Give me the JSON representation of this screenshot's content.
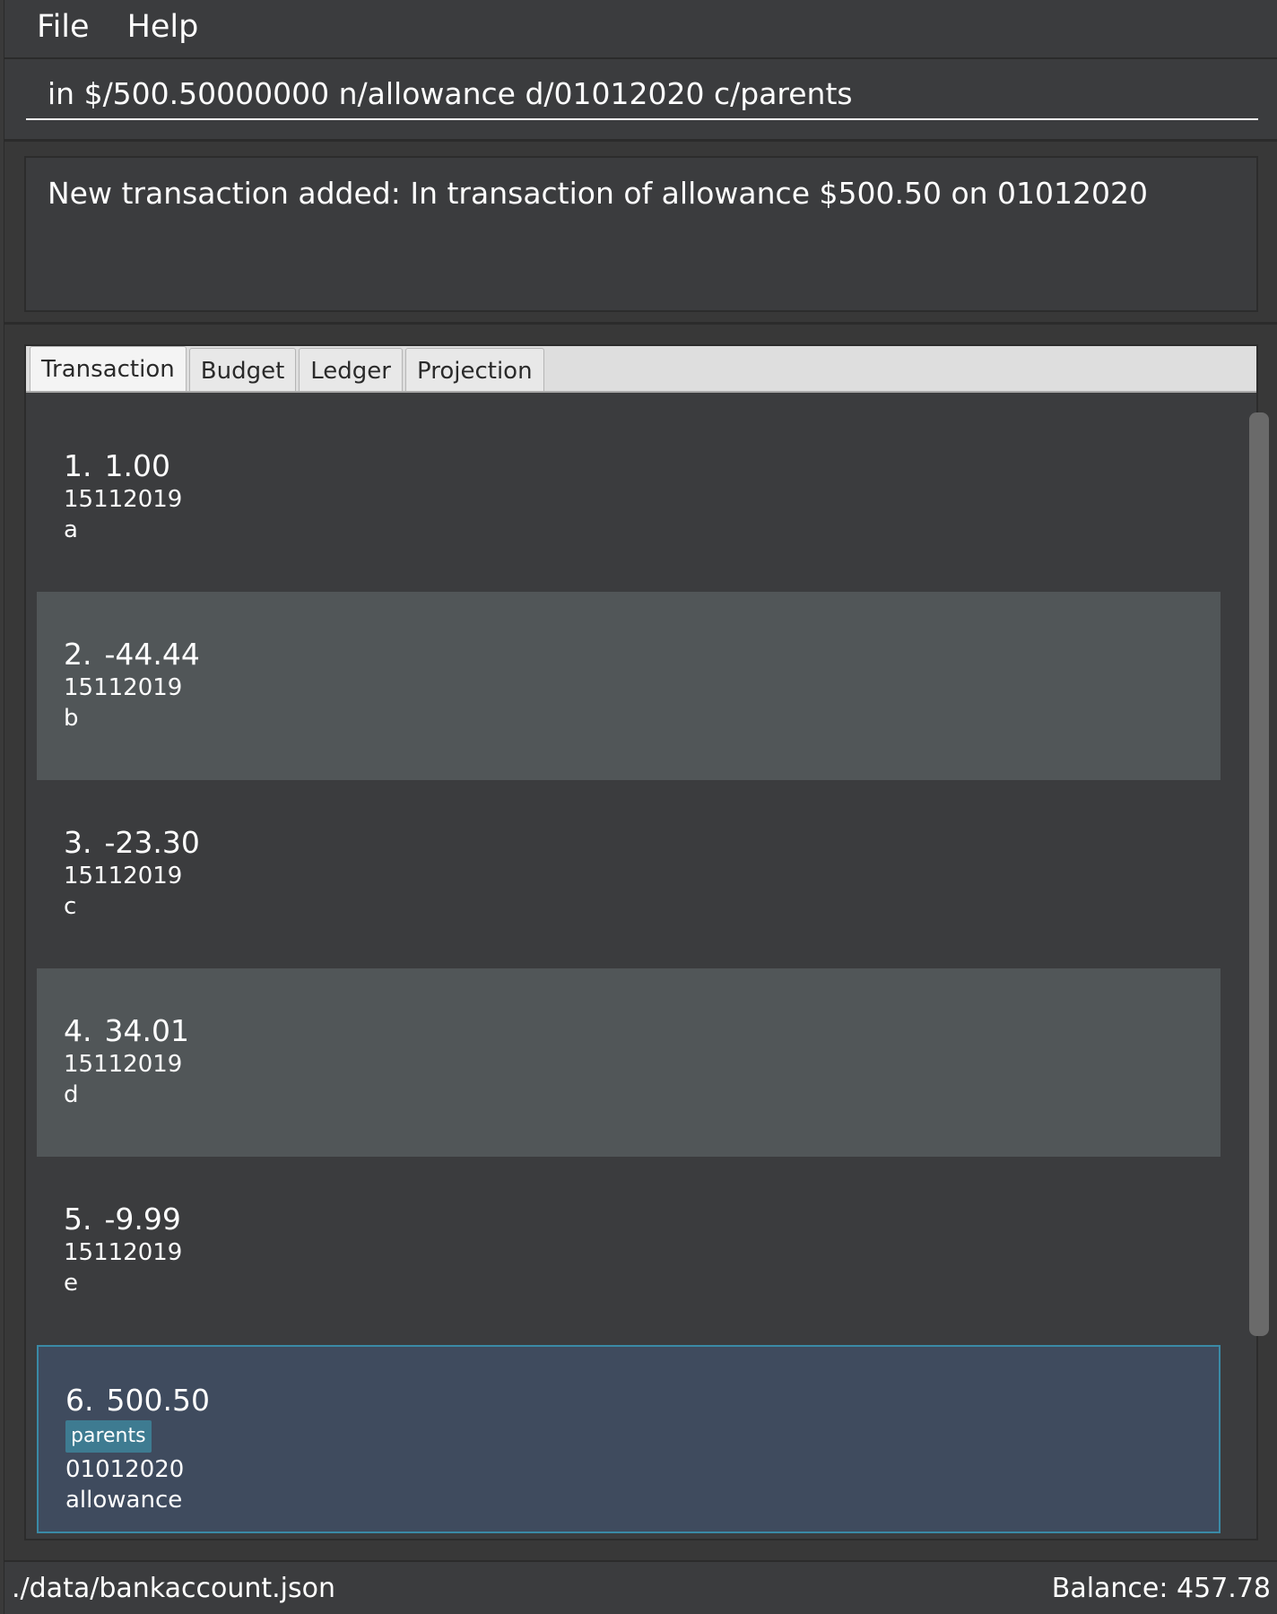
{
  "menu": {
    "file": "File",
    "help": "Help"
  },
  "command": {
    "value": "in $/500.50000000 n/allowance d/01012020 c/parents"
  },
  "result": {
    "message": "New transaction added: In transaction of allowance $500.50 on 01012020"
  },
  "tabs": [
    {
      "label": "Transaction",
      "active": true
    },
    {
      "label": "Budget"
    },
    {
      "label": "Ledger"
    },
    {
      "label": "Projection"
    }
  ],
  "transactions": [
    {
      "index": "1.",
      "amount": "1.00",
      "date": "15112019",
      "description": "a"
    },
    {
      "index": "2.",
      "amount": "-44.44",
      "date": "15112019",
      "description": "b"
    },
    {
      "index": "3.",
      "amount": "-23.30",
      "date": "15112019",
      "description": "c"
    },
    {
      "index": "4.",
      "amount": "34.01",
      "date": "15112019",
      "description": "d"
    },
    {
      "index": "5.",
      "amount": "-9.99",
      "date": "15112019",
      "description": "e"
    },
    {
      "index": "6.",
      "amount": "500.50",
      "tag": "parents",
      "date": "01012020",
      "description": "allowance",
      "selected": true
    }
  ],
  "status": {
    "path": "./data/bankaccount.json",
    "balance": "Balance: 457.78"
  }
}
